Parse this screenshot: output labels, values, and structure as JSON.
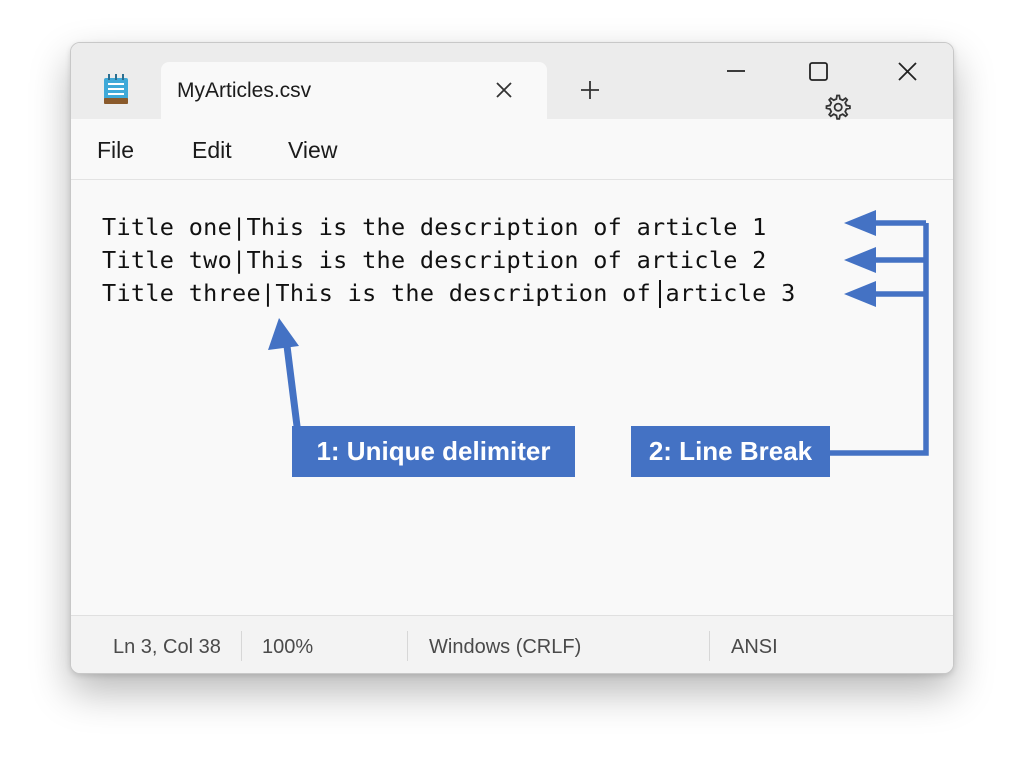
{
  "window": {
    "tab_title": "MyArticles.csv",
    "new_tab_symbol": "+"
  },
  "menu": {
    "file": "File",
    "edit": "Edit",
    "view": "View"
  },
  "editor": {
    "lines": [
      "Title one|This is the description of article 1",
      "Title two|This is the description of article 2",
      "Title three|This is the description of article 3"
    ]
  },
  "status": {
    "position": "Ln 3, Col 38",
    "zoom": "100%",
    "line_endings": "Windows (CRLF)",
    "encoding": "ANSI"
  },
  "annotations": {
    "delimiter_label": "1: Unique delimiter",
    "line_break_label": "2: Line Break"
  },
  "colors": {
    "annotation_blue": "#4472c4",
    "annotation_text": "#ffffff"
  },
  "icons": {
    "app": "notepad-icon",
    "close_tab": "close-icon",
    "new_tab": "plus-icon",
    "minimize": "minimize-icon",
    "maximize": "maximize-icon",
    "close_window": "close-icon",
    "settings": "gear-icon"
  }
}
